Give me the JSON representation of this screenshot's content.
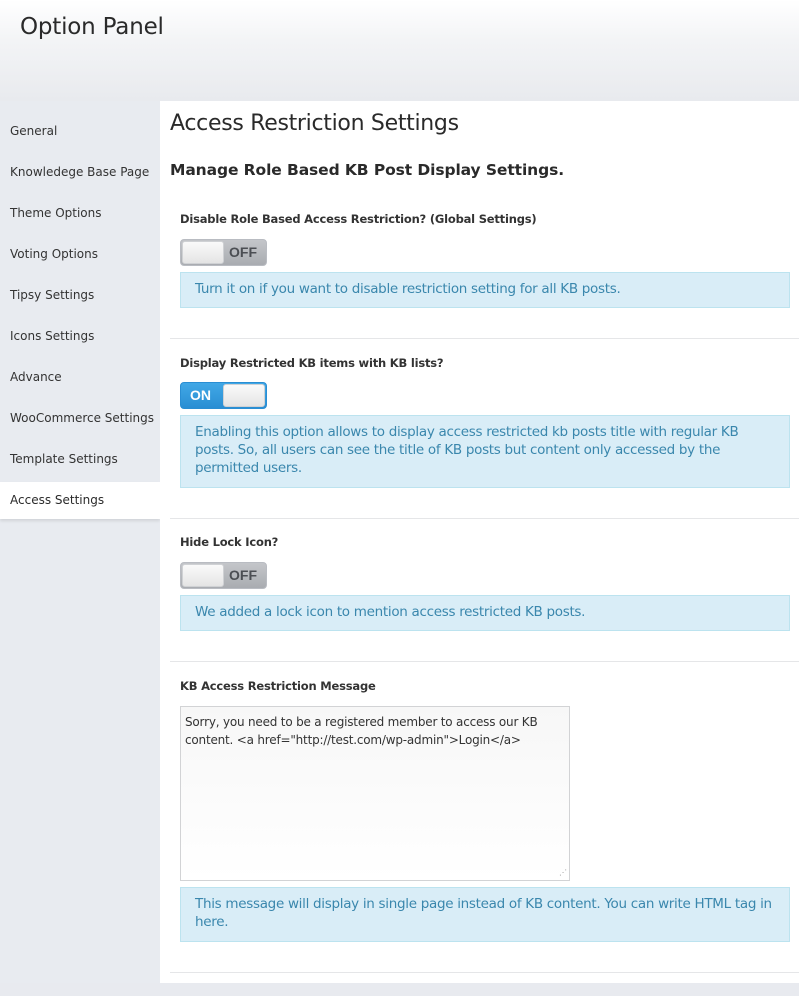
{
  "header": {
    "title": "Option Panel"
  },
  "sidebar": {
    "items": [
      {
        "label": "General",
        "active": false
      },
      {
        "label": "Knowledege Base Page",
        "active": false
      },
      {
        "label": "Theme Options",
        "active": false
      },
      {
        "label": "Voting Options",
        "active": false
      },
      {
        "label": "Tipsy Settings",
        "active": false
      },
      {
        "label": "Icons Settings",
        "active": false
      },
      {
        "label": "Advance",
        "active": false
      },
      {
        "label": "WooCommerce Settings",
        "active": false
      },
      {
        "label": "Template Settings",
        "active": false
      },
      {
        "label": "Access Settings",
        "active": true
      }
    ]
  },
  "main": {
    "title": "Access Restriction Settings",
    "subtitle": "Manage Role Based KB Post Display Settings.",
    "fields": [
      {
        "label": "Disable Role Based Access Restriction? (Global Settings)",
        "type": "toggle",
        "state": "OFF",
        "info": "Turn it on if you want to disable restriction setting for all KB posts."
      },
      {
        "label": "Display Restricted KB items with KB lists?",
        "type": "toggle",
        "state": "ON",
        "info": "Enabling this option allows to display access restricted kb posts title with regular KB posts. So, all users can see the title of KB posts but content only accessed by the permitted users."
      },
      {
        "label": "Hide Lock Icon?",
        "type": "toggle",
        "state": "OFF",
        "info": "We added a lock icon to mention access restricted KB posts."
      },
      {
        "label": "KB Access Restriction Message",
        "type": "textarea",
        "value": "Sorry, you need to be a registered member to access our KB content. <a href=\"http://test.com/wp-admin\">Login</a>",
        "info": "This message will display in single page instead of KB content. You can write HTML tag in here."
      }
    ]
  },
  "icons": {
    "resize_handle": "resize-grip-icon"
  },
  "colors": {
    "toggle_on": "#2a8ed3",
    "toggle_off": "#b4b6ba",
    "info_bg": "#d9edf7",
    "info_text": "#3a87ad",
    "sidebar_bg": "#e8ebf0"
  }
}
